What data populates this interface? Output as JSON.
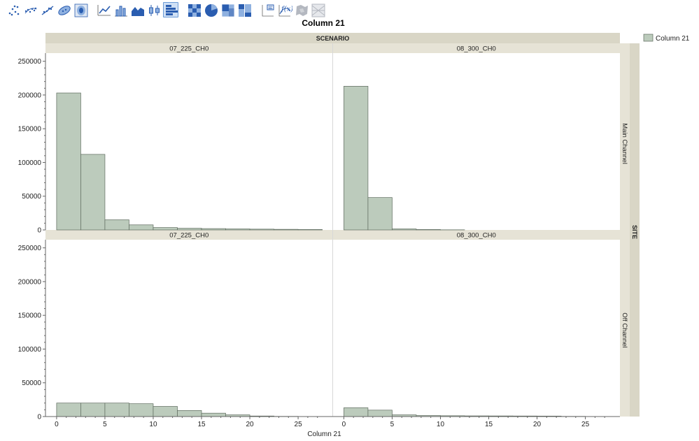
{
  "toolbar": {
    "colors": {
      "blue": "#2a5db0",
      "light": "#8fb1e0",
      "gray": "#b4b8c0"
    },
    "groups": [
      [
        {
          "icon": "points-icon"
        },
        {
          "icon": "jittered-points-icon"
        },
        {
          "icon": "line-of-fit-icon"
        },
        {
          "icon": "ellipse-icon"
        },
        {
          "icon": "contour-icon"
        }
      ],
      [
        {
          "icon": "line-chart-icon"
        },
        {
          "icon": "bar-chart-icon"
        },
        {
          "icon": "area-chart-icon"
        },
        {
          "icon": "box-plot-icon"
        },
        {
          "icon": "histogram-icon",
          "active": true
        }
      ],
      [
        {
          "icon": "heatmap-icon"
        },
        {
          "icon": "pie-chart-icon"
        },
        {
          "icon": "treemap-icon"
        },
        {
          "icon": "mosaic-icon"
        }
      ],
      [
        {
          "icon": "caption-box-icon"
        },
        {
          "icon": "formula-icon"
        },
        {
          "icon": "map-shapes-icon"
        },
        {
          "icon": "parallel-icon"
        }
      ]
    ]
  },
  "chart_data": {
    "type": "bar",
    "title": "Column 21",
    "xlabel": "Column 21",
    "ylabel": "",
    "column_group_label": "SCENARIO",
    "row_group_label": "SITE",
    "columns": [
      "07_225_CH0",
      "08_300_CH0"
    ],
    "rows": [
      "Main Channel",
      "Off Channel"
    ],
    "legend": {
      "position": "top-right",
      "entries": [
        {
          "label": "Column 21",
          "color": "#bccbbc"
        }
      ]
    },
    "colors": {
      "bar_fill": "#bccbbc",
      "bar_stroke": "#5d6a5d",
      "strip": "#e6e3d6",
      "strip_dark": "#d9d6c6",
      "axis": "#666666",
      "grid": "#cccccc"
    },
    "ylim": [
      0,
      260000
    ],
    "yticks": [
      0,
      50000,
      100000,
      150000,
      200000,
      250000
    ],
    "xlim": [
      -0.5,
      28
    ],
    "xticks": [
      0,
      5,
      10,
      15,
      20,
      25
    ],
    "bin_width": 2.5,
    "panels": [
      {
        "row": 0,
        "col": 0,
        "bins": [
          0,
          2.5,
          5,
          7.5,
          10,
          12.5,
          15,
          17.5,
          20,
          22.5,
          25
        ],
        "values": [
          203000,
          112000,
          15000,
          7500,
          3500,
          2500,
          2000,
          1500,
          1200,
          900,
          600
        ]
      },
      {
        "row": 0,
        "col": 1,
        "bins": [
          0,
          2.5,
          5,
          7.5,
          10
        ],
        "values": [
          213000,
          48000,
          1500,
          600,
          200
        ]
      },
      {
        "row": 1,
        "col": 0,
        "bins": [
          0,
          2.5,
          5,
          7.5,
          10,
          12.5,
          15,
          17.5,
          20,
          22.5
        ],
        "values": [
          20000,
          20000,
          20000,
          19000,
          15000,
          9000,
          5000,
          2500,
          800,
          300
        ]
      },
      {
        "row": 1,
        "col": 1,
        "bins": [
          0,
          2.5,
          5,
          7.5,
          10,
          12.5,
          15,
          17.5,
          20,
          22.5
        ],
        "values": [
          13000,
          9500,
          2500,
          1500,
          1200,
          1000,
          900,
          800,
          700,
          300
        ]
      }
    ]
  }
}
